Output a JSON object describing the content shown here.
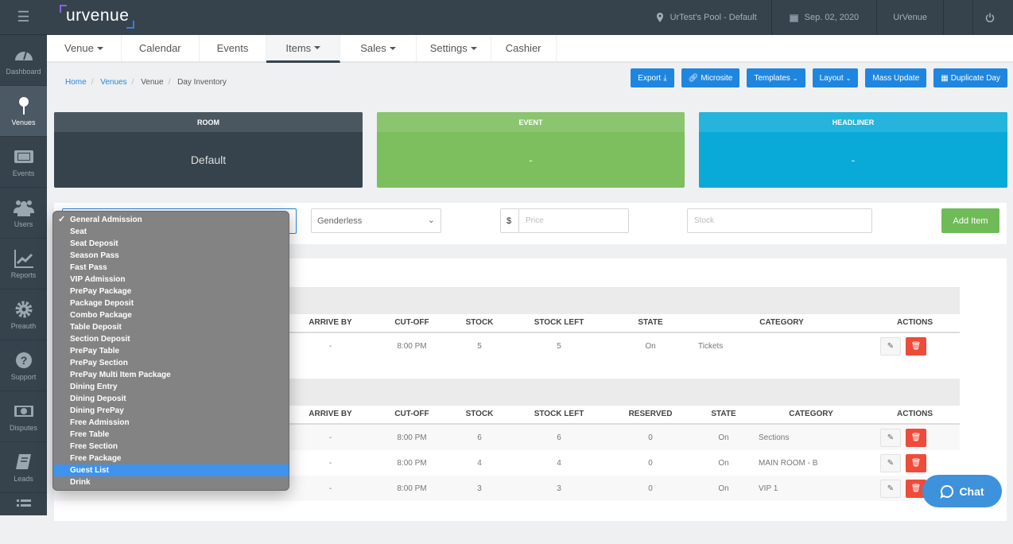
{
  "app": {
    "logo_text": "urvenue"
  },
  "topbar": {
    "location": "UrTest's Pool - Default",
    "date": "Sep. 02, 2020",
    "user": "UrVenue"
  },
  "sidebar": {
    "items": [
      {
        "label": "Dashboard",
        "icon": "dashboard-icon"
      },
      {
        "label": "Venues",
        "icon": "map-pin-icon",
        "active": true
      },
      {
        "label": "Events",
        "icon": "ticket-icon"
      },
      {
        "label": "Users",
        "icon": "users-icon"
      },
      {
        "label": "Reports",
        "icon": "chart-line-icon"
      },
      {
        "label": "Preauth",
        "icon": "gear-icon"
      },
      {
        "label": "Support",
        "icon": "question-icon"
      },
      {
        "label": "Disputes",
        "icon": "money-icon"
      },
      {
        "label": "Leads",
        "icon": "book-icon"
      }
    ]
  },
  "nav": {
    "items": [
      {
        "label": "Venue",
        "caret": true
      },
      {
        "label": "Calendar"
      },
      {
        "label": "Events"
      },
      {
        "label": "Items",
        "caret": true,
        "active": true
      },
      {
        "label": "Sales",
        "caret": true
      },
      {
        "label": "Settings",
        "caret": true
      },
      {
        "label": "Cashier"
      }
    ]
  },
  "breadcrumb": {
    "home": "Home",
    "venues": "Venues",
    "venue": "Venue",
    "current": "Day Inventory"
  },
  "toolbar": {
    "export": "Export",
    "microsite": "Microsite",
    "templates": "Templates",
    "layout": "Layout",
    "mass_update": "Mass Update",
    "duplicate_day": "Duplicate Day"
  },
  "cards": {
    "room": {
      "title": "ROOM",
      "value": "Default",
      "color": "#36434d"
    },
    "event": {
      "title": "EVENT",
      "value": "-",
      "color": "#7dbe5e"
    },
    "headliner": {
      "title": "HEADLINER",
      "value": "-",
      "color": "#0aaad8"
    }
  },
  "form": {
    "gender": "Genderless",
    "currency": "$",
    "price_placeholder": "Price",
    "stock_placeholder": "Stock",
    "add_item": "Add Item"
  },
  "dropdown": {
    "selected": "General Admission",
    "highlighted": "Guest List",
    "options": [
      "General Admission",
      "Seat",
      "Seat Deposit",
      "Season Pass",
      "Fast Pass",
      "VIP Admission",
      "PrePay Package",
      "Package Deposit",
      "Combo Package",
      "Table Deposit",
      "Section Deposit",
      "PrePay Table",
      "PrePay Section",
      "PrePay Multi Item Package",
      "Dining Entry",
      "Dining Deposit",
      "Dining PrePay",
      "Free Admission",
      "Free Table",
      "Free Section",
      "Free Package",
      "Guest List",
      "Drink"
    ]
  },
  "table1": {
    "headers": {
      "arrive_by": "ARRIVE BY",
      "cutoff": "CUT-OFF",
      "stock": "STOCK",
      "stock_left": "STOCK LEFT",
      "state": "STATE",
      "category": "CATEGORY",
      "actions": "ACTIONS"
    },
    "rows": [
      {
        "arrive_by": "-",
        "cutoff": "8:00 PM",
        "stock": "5",
        "stock_left": "5",
        "state": "On",
        "category": "Tickets"
      }
    ]
  },
  "table2": {
    "headers": {
      "arrive_by": "ARRIVE BY",
      "cutoff": "CUT-OFF",
      "stock": "STOCK",
      "stock_left": "STOCK LEFT",
      "reserved": "RESERVED",
      "state": "STATE",
      "category": "CATEGORY",
      "actions": "ACTIONS"
    },
    "rows": [
      {
        "arrive_by": "-",
        "cutoff": "8:00 PM",
        "stock": "6",
        "stock_left": "6",
        "reserved": "0",
        "state": "On",
        "category": "Sections"
      },
      {
        "arrive_by": "-",
        "cutoff": "8:00 PM",
        "stock": "4",
        "stock_left": "4",
        "reserved": "0",
        "state": "On",
        "category": "MAIN ROOM - B"
      },
      {
        "arrive_by": "-",
        "cutoff": "8:00 PM",
        "stock": "3",
        "stock_left": "3",
        "reserved": "0",
        "state": "On",
        "category": "VIP 1"
      }
    ]
  },
  "chat": {
    "label": "Chat"
  }
}
